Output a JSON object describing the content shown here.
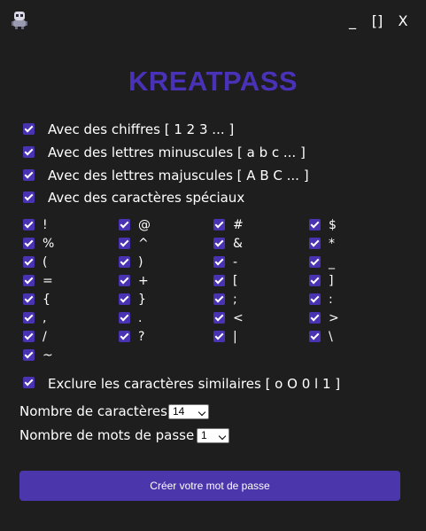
{
  "window": {
    "icon": "robot-icon",
    "minimize_label": "_",
    "maximize_label": "[]",
    "close_label": "X"
  },
  "title": "KREATPASS",
  "options": {
    "digits": {
      "label": "Avec des chiffres [ 1 2 3 ... ]",
      "checked": true
    },
    "lowercase": {
      "label": "Avec des lettres minuscules [ a b c ... ]",
      "checked": true
    },
    "uppercase": {
      "label": "Avec des lettres majuscules [ A B C ... ]",
      "checked": true
    },
    "special": {
      "label": "Avec des caractères spéciaux",
      "checked": true
    }
  },
  "special_chars": [
    "!",
    "@",
    "#",
    "$",
    "%",
    "^",
    "&",
    "*",
    "(",
    ")",
    "-",
    "_",
    "=",
    "+",
    "[",
    "]",
    "{",
    "}",
    ";",
    ":",
    ",",
    ".",
    "<",
    ">",
    "/",
    "?",
    "|",
    "\\",
    "~"
  ],
  "exclude_similar": {
    "label": "Exclure les caractères similaires [ o O 0 l 1 ]",
    "checked": true
  },
  "length": {
    "label": "Nombre de caractères :",
    "value": "14"
  },
  "count": {
    "label": "Nombre de mots de passe :",
    "value": "1"
  },
  "create_button": "Créer votre mot de passe",
  "colors": {
    "accent": "#4b36ab",
    "title": "#4a32b8",
    "background": "#1e1e1e"
  }
}
